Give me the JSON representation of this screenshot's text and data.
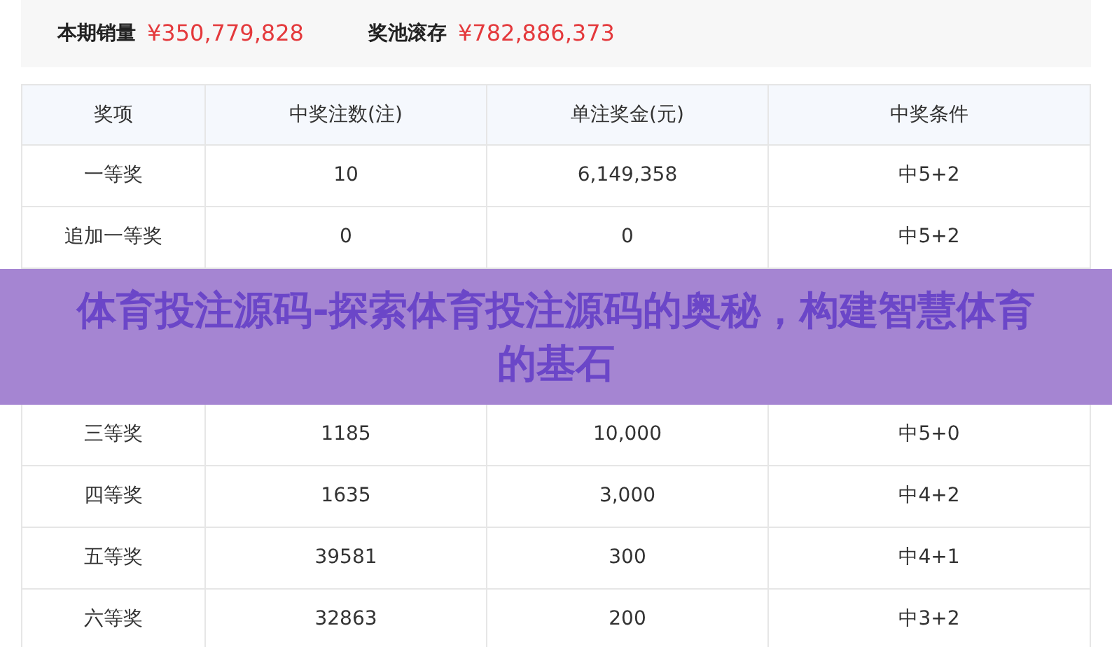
{
  "summary": [
    {
      "label": "本期销量",
      "value": "¥350,779,828"
    },
    {
      "label": "奖池滚存",
      "value": "¥782,886,373"
    }
  ],
  "table": {
    "columns": [
      "奖项",
      "中奖注数(注)",
      "单注奖金(元)",
      "中奖条件"
    ],
    "rows_before_banner": [
      [
        "一等奖",
        "10",
        "6,149,358",
        "中5+2"
      ],
      [
        "追加一等奖",
        "0",
        "0",
        "中5+2"
      ]
    ],
    "rows_after_banner": [
      [
        "三等奖",
        "1185",
        "10,000",
        "中5+0"
      ],
      [
        "四等奖",
        "1635",
        "3,000",
        "中4+2"
      ],
      [
        "五等奖",
        "39581",
        "300",
        "中4+1"
      ],
      [
        "六等奖",
        "32863",
        "200",
        "中3+2"
      ]
    ]
  },
  "banner": {
    "title": "体育投注源码-探索体育投注源码的奥秘，构建智慧体育的基石"
  }
}
